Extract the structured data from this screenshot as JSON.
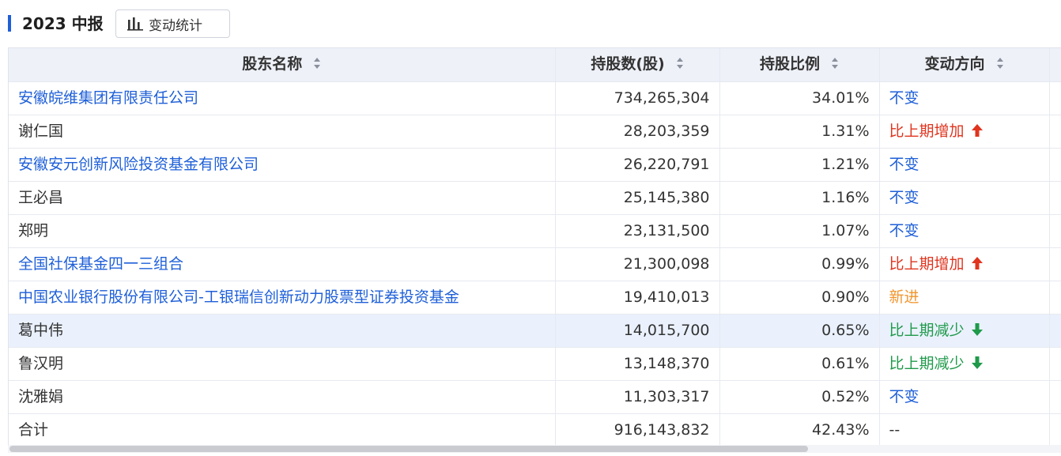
{
  "header": {
    "title": "2023 中报",
    "stats_button_label": "变动统计",
    "stats_icon": "bar-chart-icon",
    "accent_color": "#1e5fd8"
  },
  "table": {
    "columns": [
      {
        "label": "股东名称",
        "sortable": true
      },
      {
        "label": "持股数(股)",
        "sortable": true
      },
      {
        "label": "持股比例",
        "sortable": true
      },
      {
        "label": "变动方向",
        "sortable": true
      }
    ],
    "rows": [
      {
        "name": "安徽皖维集团有限责任公司",
        "name_link": true,
        "shares": "734,265,304",
        "ratio": "34.01%",
        "direction": "不变",
        "dir_type": "same"
      },
      {
        "name": "谢仁国",
        "name_link": false,
        "shares": "28,203,359",
        "ratio": "1.31%",
        "direction": "比上期增加",
        "dir_type": "inc"
      },
      {
        "name": "安徽安元创新风险投资基金有限公司",
        "name_link": true,
        "shares": "26,220,791",
        "ratio": "1.21%",
        "direction": "不变",
        "dir_type": "same"
      },
      {
        "name": "王必昌",
        "name_link": false,
        "shares": "25,145,380",
        "ratio": "1.16%",
        "direction": "不变",
        "dir_type": "same"
      },
      {
        "name": "郑明",
        "name_link": false,
        "shares": "23,131,500",
        "ratio": "1.07%",
        "direction": "不变",
        "dir_type": "same"
      },
      {
        "name": "全国社保基金四一三组合",
        "name_link": true,
        "shares": "21,300,098",
        "ratio": "0.99%",
        "direction": "比上期增加",
        "dir_type": "inc"
      },
      {
        "name": "中国农业银行股份有限公司-工银瑞信创新动力股票型证券投资基金",
        "name_link": true,
        "shares": "19,410,013",
        "ratio": "0.90%",
        "direction": "新进",
        "dir_type": "new"
      },
      {
        "name": "葛中伟",
        "name_link": false,
        "shares": "14,015,700",
        "ratio": "0.65%",
        "direction": "比上期减少",
        "dir_type": "dec",
        "highlight": true
      },
      {
        "name": "鲁汉明",
        "name_link": false,
        "shares": "13,148,370",
        "ratio": "0.61%",
        "direction": "比上期减少",
        "dir_type": "dec"
      },
      {
        "name": "沈雅娟",
        "name_link": false,
        "shares": "11,303,317",
        "ratio": "0.52%",
        "direction": "不变",
        "dir_type": "same"
      }
    ],
    "total": {
      "name": "合计",
      "shares": "916,143,832",
      "ratio": "42.43%",
      "direction": "--"
    }
  },
  "colors": {
    "link": "#1e5fd8",
    "increase": "#e0341e",
    "decrease": "#1f9a4a",
    "new": "#f0962f",
    "header_bg": "#eef1f8",
    "highlight_row": "#eaf1fd"
  },
  "icons": {
    "sort": "sort-icon",
    "increase": "arrow-up-icon",
    "decrease": "arrow-down-icon"
  }
}
